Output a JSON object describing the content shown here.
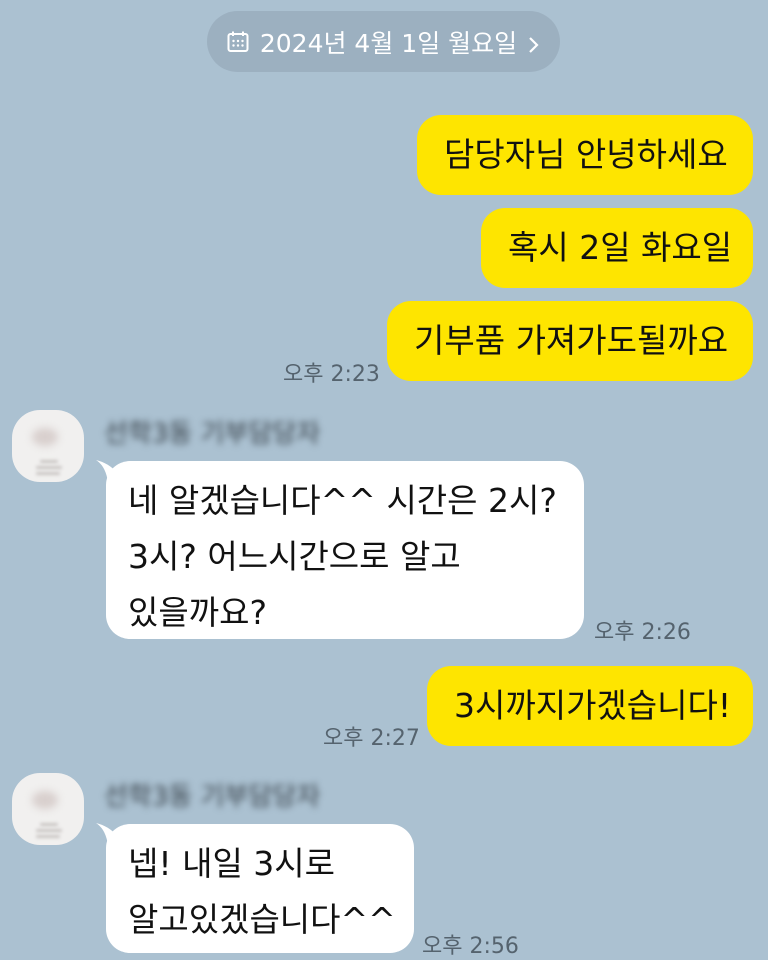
{
  "date_header": {
    "label": "2024년 4월 1일 월요일",
    "icon": "calendar-icon",
    "chevron": "chevron-right-icon"
  },
  "messages": [
    {
      "side": "me",
      "text": "담당자님 안녕하세요"
    },
    {
      "side": "me",
      "text": "혹시 2일 화요일"
    },
    {
      "side": "me",
      "text": "기부품 가져가도될까요",
      "time": "오후 2:23"
    },
    {
      "side": "them",
      "sender": "선학3동 기부담당자",
      "lines": [
        "네 알겠습니다^^ 시간은 2시?",
        "3시? 어느시간으로 알고",
        "있을까요?"
      ],
      "time": "오후 2:26"
    },
    {
      "side": "me",
      "text": "3시까지가겠습니다!",
      "time": "오후 2:27"
    },
    {
      "side": "them",
      "sender": "선학3동 기부담당자",
      "lines": [
        "넵! 내일 3시로",
        "알고있겠습니다^^"
      ],
      "time": "오후 2:56"
    }
  ],
  "colors": {
    "background": "#abc1d1",
    "my_bubble": "#fee500",
    "their_bubble": "#ffffff",
    "date_pill": "#9cb0c0"
  }
}
